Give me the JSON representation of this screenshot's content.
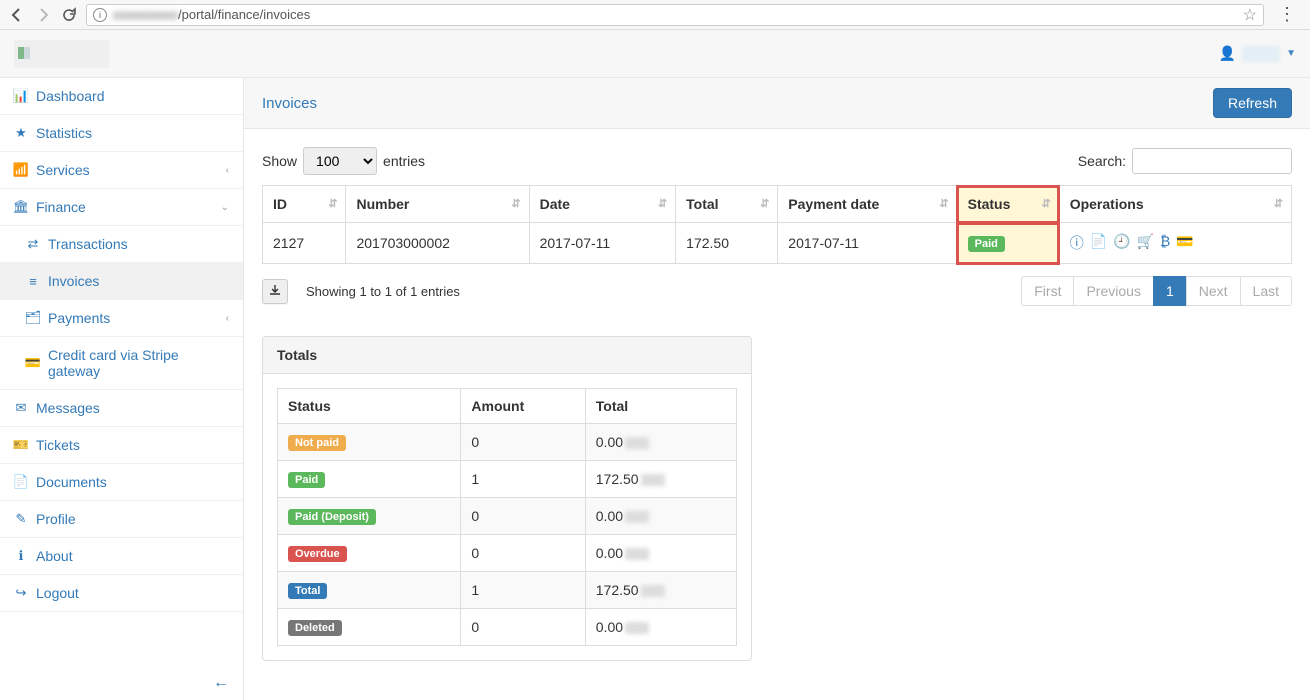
{
  "url_visible": "/portal/finance/invoices",
  "user": {
    "label": ""
  },
  "sidebar": {
    "items": [
      {
        "icon": "📊",
        "label": "Dashboard"
      },
      {
        "icon": "★",
        "label": "Statistics"
      },
      {
        "icon": "📶",
        "label": "Services",
        "chev": "‹"
      },
      {
        "icon": "🏛",
        "label": "Finance",
        "chev": "⌄",
        "open": true,
        "sub": [
          {
            "icon": "⇄",
            "label": "Transactions"
          },
          {
            "icon": "≡",
            "label": "Invoices",
            "active": true
          },
          {
            "icon": "🗂",
            "label": "Payments",
            "chev": "‹"
          },
          {
            "icon": "💳",
            "label": "Credit card via Stripe gateway"
          }
        ]
      },
      {
        "icon": "✉",
        "label": "Messages"
      },
      {
        "icon": "🎫",
        "label": "Tickets"
      },
      {
        "icon": "📄",
        "label": "Documents"
      },
      {
        "icon": "✎",
        "label": "Profile"
      },
      {
        "icon": "ℹ",
        "label": "About"
      },
      {
        "icon": "↪",
        "label": "Logout"
      }
    ]
  },
  "page": {
    "title": "Invoices",
    "refresh_label": "Refresh"
  },
  "table": {
    "show_label": "Show",
    "entries_label": "entries",
    "show_value": "100",
    "search_label": "Search:",
    "columns": [
      "ID",
      "Number",
      "Date",
      "Total",
      "Payment date",
      "Status",
      "Operations"
    ],
    "row": {
      "id": "2127",
      "number": "201703000002",
      "date": "2017-07-11",
      "total": "172.50",
      "payment_date": "2017-07-11",
      "status_label": "Paid"
    },
    "footer_info": "Showing 1 to 1 of 1 entries",
    "pager": {
      "first": "First",
      "prev": "Previous",
      "page": "1",
      "next": "Next",
      "last": "Last"
    }
  },
  "totals": {
    "title": "Totals",
    "headers": [
      "Status",
      "Amount",
      "Total"
    ],
    "rows": [
      {
        "label": "Not paid",
        "cls": "badge-warning",
        "amount": "0",
        "total": "0.00"
      },
      {
        "label": "Paid",
        "cls": "badge-success",
        "amount": "1",
        "total": "172.50"
      },
      {
        "label": "Paid (Deposit)",
        "cls": "badge-success",
        "amount": "0",
        "total": "0.00"
      },
      {
        "label": "Overdue",
        "cls": "badge-danger",
        "amount": "0",
        "total": "0.00"
      },
      {
        "label": "Total",
        "cls": "badge-info",
        "amount": "1",
        "total": "172.50"
      },
      {
        "label": "Deleted",
        "cls": "badge-default",
        "amount": "0",
        "total": "0.00"
      }
    ]
  }
}
